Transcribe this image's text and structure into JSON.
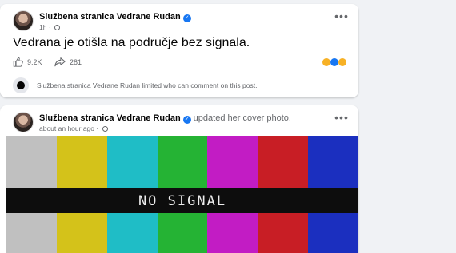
{
  "post1": {
    "author": "Službena stranica Vedrane Rudan",
    "time": "1h",
    "text": "Vedrana je otišla na područje bez signala.",
    "likes": "9.2K",
    "shares": "281",
    "limited_notice": "Službena stranica Vedrane Rudan limited who can comment on this post."
  },
  "post2": {
    "author": "Službena stranica Vedrane Rudan",
    "action": "updated her cover photo.",
    "time": "about an hour ago",
    "cover_text": "NO SIGNAL",
    "colors": {
      "bar_colors": [
        "#c0c0c0",
        "#d4c21a",
        "#1fbdc6",
        "#25b334",
        "#c21cc4",
        "#c81e25",
        "#1b2fbf"
      ]
    }
  },
  "icons": {
    "like": "like-icon",
    "share": "share-icon",
    "verified": "verified-badge-icon",
    "globe": "globe-icon",
    "more": "more-options-icon"
  }
}
